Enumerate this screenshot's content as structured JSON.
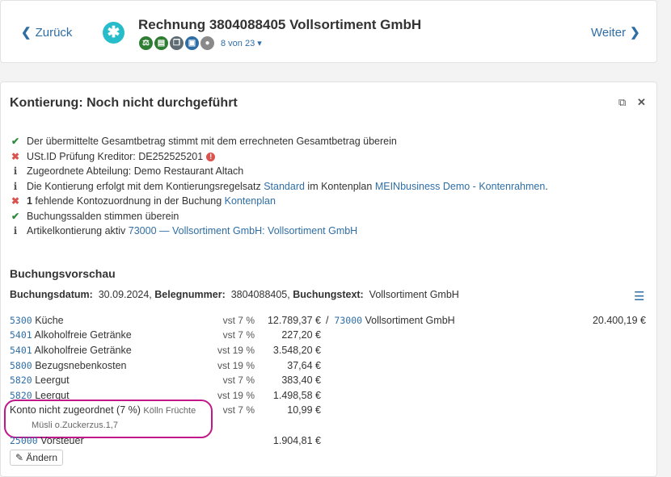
{
  "nav": {
    "back": "Zurück",
    "next": "Weiter"
  },
  "header": {
    "title": "Rechnung 3804088405 Vollsortiment GmbH",
    "counter": "8 von 23",
    "logo_glyph": "✱"
  },
  "status_icons": [
    {
      "name": "scales-icon",
      "glyph": "⚖",
      "color": "#2e7d32"
    },
    {
      "name": "document-icon",
      "glyph": "▤",
      "color": "#2e7d32"
    },
    {
      "name": "copy-icon",
      "glyph": "❐",
      "color": "#5f6b73"
    },
    {
      "name": "money-icon",
      "glyph": "▣",
      "color": "#2f6ea5"
    },
    {
      "name": "comment-icon",
      "glyph": "●",
      "color": "#8a8a8a"
    }
  ],
  "panel": {
    "title": "Kontierung: Noch nicht durchgeführt"
  },
  "checks": [
    {
      "status": "ok",
      "symbol": "✔",
      "text": "Der übermittelte Gesamtbetrag stimmt mit dem errechneten Gesamtbetrag überein"
    },
    {
      "status": "err",
      "symbol": "✖",
      "text": "USt.ID Prüfung Kreditor: DE252525201"
    },
    {
      "status": "info",
      "symbol": "i",
      "text": "Zugeordnete Abteilung: Demo Restaurant Altach"
    },
    {
      "status": "info",
      "symbol": "i",
      "t1": "Die Kontierung erfolgt mit dem Kontierungsregelsatz ",
      "l1": "Standard",
      "t2": " im Kontenplan ",
      "l2": "MEINbusiness Demo - Kontenrahmen",
      "t3": "."
    },
    {
      "status": "err",
      "symbol": "✖",
      "bold": "1",
      "text": " fehlende Kontozuordnung in der Buchung ",
      "link": "Kontenplan"
    },
    {
      "status": "ok",
      "symbol": "✔",
      "text": "Buchungssalden stimmen überein"
    },
    {
      "status": "info",
      "symbol": "i",
      "text": "Artikelkontierung aktiv ",
      "link": "73000 — Vollsortiment GmbH: Vollsortiment GmbH"
    }
  ],
  "preview": {
    "title": "Buchungsvorschau",
    "date_label": "Buchungsdatum:",
    "date": "30.09.2024",
    "receipt_label": "Belegnummer:",
    "receipt": "3804088405",
    "text_label": "Buchungstext:",
    "text": "Vollsortiment GmbH",
    "credit_num": "73000",
    "credit_name": "Vollsortiment GmbH",
    "credit_amount": "20.400,19 €",
    "rows": [
      {
        "num": "5300",
        "name": "Küche",
        "vat": "vst 7 %",
        "amount": "12.789,37 €"
      },
      {
        "num": "5401",
        "name": "Alkoholfreie Getränke",
        "vat": "vst 7 %",
        "amount": "227,20 €"
      },
      {
        "num": "5401",
        "name": "Alkoholfreie Getränke",
        "vat": "vst 19 %",
        "amount": "3.548,20 €"
      },
      {
        "num": "5800",
        "name": "Bezugsnebenkosten",
        "vat": "vst 19 %",
        "amount": "37,64 €"
      },
      {
        "num": "5820",
        "name": "Leergut",
        "vat": "vst 7 %",
        "amount": "383,40 €"
      },
      {
        "num": "5820",
        "name": "Leergut",
        "vat": "vst 19 %",
        "amount": "1.498,58 €"
      }
    ],
    "unassigned": {
      "label": "Konto nicht zugeordnet (7 %)",
      "item1": "Kölln Früchte",
      "item2": "Müsli o.Zuckerzus.1,7",
      "vat": "vst 7 %",
      "amount": "10,99 €"
    },
    "tax": {
      "num": "25000",
      "name": "Vorsteuer",
      "amount": "1.904,81 €"
    },
    "edit": "Ändern"
  }
}
